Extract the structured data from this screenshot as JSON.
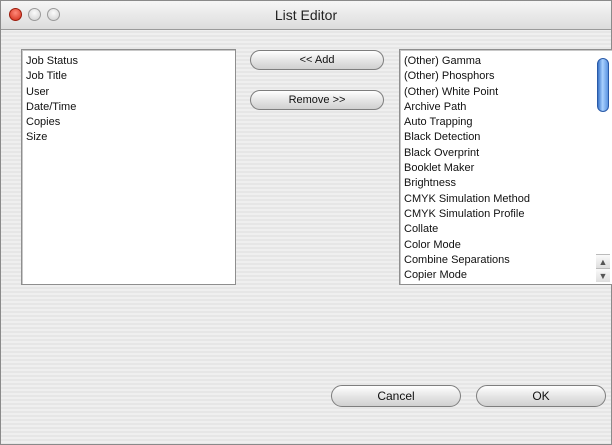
{
  "window": {
    "title": "List Editor"
  },
  "left_list": {
    "items": [
      "Job Status",
      "Job Title",
      "User",
      "Date/Time",
      "Copies",
      "Size"
    ]
  },
  "buttons": {
    "add": "<< Add",
    "remove": "Remove >>",
    "cancel": "Cancel",
    "ok": "OK"
  },
  "right_list": {
    "items": [
      "(Other) Gamma",
      "(Other) Phosphors",
      "(Other) White Point",
      "Archive Path",
      "Auto Trapping",
      "Black Detection",
      "Black Overprint",
      "Booklet Maker",
      "Brightness",
      "CMYK Simulation Method",
      "CMYK Simulation Profile",
      "Collate",
      "Color Mode",
      "Combine Separations",
      "Copier Mode"
    ]
  },
  "scroll_arrows": {
    "up": "▲",
    "down": "▼"
  }
}
